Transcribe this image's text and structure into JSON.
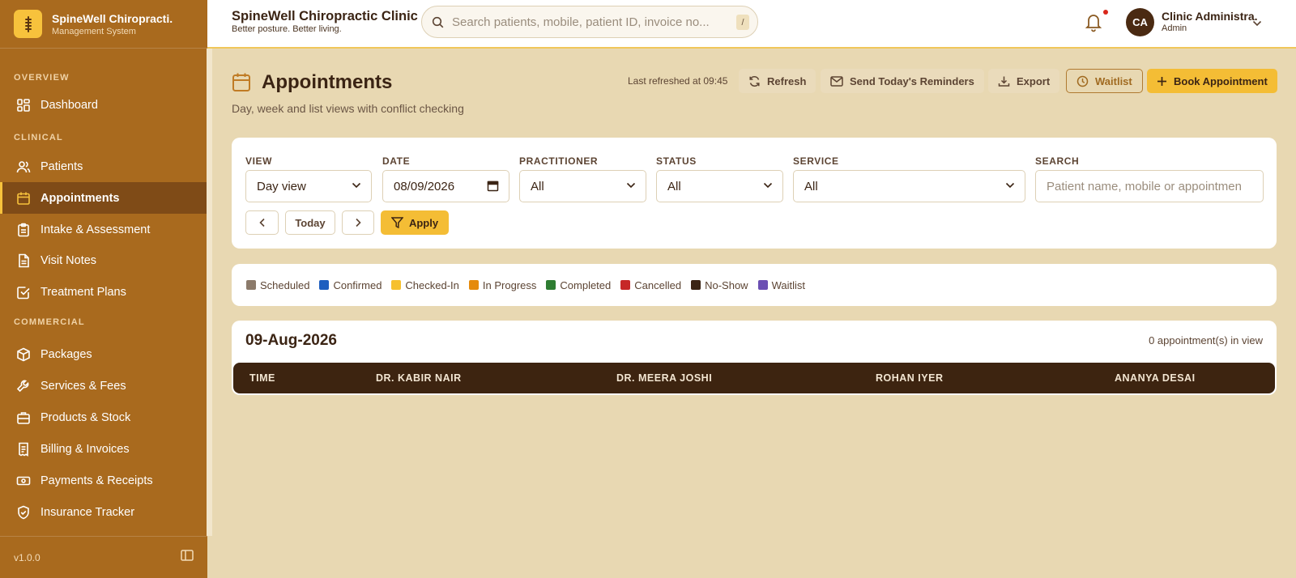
{
  "brand": {
    "title": "SpineWell Chiropracti.",
    "subtitle": "Management System"
  },
  "sidebar": {
    "sections": [
      "OVERVIEW",
      "CLINICAL",
      "COMMERCIAL"
    ],
    "items": [
      {
        "label": "Dashboard",
        "icon": "dashboard-icon"
      },
      {
        "label": "Patients",
        "icon": "users-icon"
      },
      {
        "label": "Appointments",
        "icon": "calendar-icon",
        "active": true
      },
      {
        "label": "Intake & Assessment",
        "icon": "clipboard-icon"
      },
      {
        "label": "Visit Notes",
        "icon": "file-text-icon"
      },
      {
        "label": "Treatment Plans",
        "icon": "check-square-icon"
      },
      {
        "label": "Packages",
        "icon": "package-icon"
      },
      {
        "label": "Services & Fees",
        "icon": "wrench-icon"
      },
      {
        "label": "Products & Stock",
        "icon": "briefcase-icon"
      },
      {
        "label": "Billing & Invoices",
        "icon": "receipt-icon"
      },
      {
        "label": "Payments & Receipts",
        "icon": "banknote-icon"
      },
      {
        "label": "Insurance Tracker",
        "icon": "shield-icon"
      }
    ],
    "version": "v1.0.0"
  },
  "topbar": {
    "clinic_name": "SpineWell Chiropractic Clinic",
    "tagline": "Better posture. Better living.",
    "search_placeholder": "Search patients, mobile, patient ID, invoice no...",
    "search_shortcut": "/",
    "user_initials": "CA",
    "user_name": "Clinic Administra.",
    "user_role": "Admin"
  },
  "page": {
    "title": "Appointments",
    "subtitle": "Day, week and list views with conflict checking",
    "last_refreshed": "Last refreshed at 09:45",
    "actions": {
      "refresh": "Refresh",
      "reminders": "Send Today's Reminders",
      "export": "Export",
      "waitlist": "Waitlist",
      "book": "Book Appointment"
    }
  },
  "filters": {
    "view": {
      "label": "VIEW",
      "value": "Day view"
    },
    "date": {
      "label": "DATE",
      "value": "08/09/2026"
    },
    "practitioner": {
      "label": "PRACTITIONER",
      "value": "All"
    },
    "status": {
      "label": "STATUS",
      "value": "All"
    },
    "service": {
      "label": "SERVICE",
      "value": "All"
    },
    "search": {
      "label": "SEARCH",
      "placeholder": "Patient name, mobile or appointmen"
    },
    "today_label": "Today",
    "apply_label": "Apply"
  },
  "legend": [
    {
      "label": "Scheduled",
      "color": "#8c7b6b"
    },
    {
      "label": "Confirmed",
      "color": "#1f5fbf"
    },
    {
      "label": "Checked-In",
      "color": "#f6c02f"
    },
    {
      "label": "In Progress",
      "color": "#e58a0c"
    },
    {
      "label": "Completed",
      "color": "#2e7d32"
    },
    {
      "label": "Cancelled",
      "color": "#c62828"
    },
    {
      "label": "No-Show",
      "color": "#3b2414"
    },
    {
      "label": "Waitlist",
      "color": "#6b4fb3"
    }
  ],
  "schedule": {
    "date": "09-Aug-2026",
    "count_text": "0 appointment(s) in view",
    "columns": [
      "TIME",
      "DR. KABIR NAIR",
      "DR. MEERA JOSHI",
      "ROHAN IYER",
      "ANANYA DESAI"
    ]
  },
  "colors": {
    "sidebar": "#a96a1e",
    "active": "#7f4b17",
    "accent": "#f4bd35",
    "page_bg": "#e8d8b2",
    "table_header": "#3d2410"
  }
}
